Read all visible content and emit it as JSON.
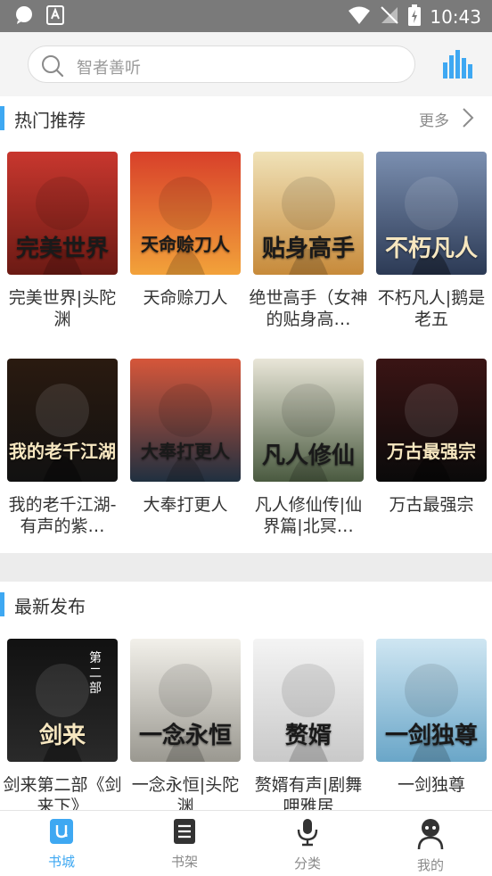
{
  "status_bar": {
    "time": "10:43"
  },
  "search": {
    "placeholder": "智者善听"
  },
  "hot": {
    "title": "热门推荐",
    "more": "更多",
    "books": [
      {
        "title": "完美世界|头陀渊",
        "cover_text": "完美世界",
        "colors": [
          "#c8372e",
          "#6b1a14"
        ]
      },
      {
        "title": "天命赊刀人",
        "cover_text": "天命赊刀人",
        "colors": [
          "#d8402a",
          "#f2a23a"
        ]
      },
      {
        "title": "绝世高手（女神的贴身高…",
        "cover_text": "贴身高手",
        "colors": [
          "#f0e2b8",
          "#c78a3a"
        ]
      },
      {
        "title": "不朽凡人|鹅是老五",
        "cover_text": "不朽凡人",
        "colors": [
          "#7b8fb0",
          "#2c3a55"
        ]
      },
      {
        "title": "我的老千江湖-有声的紫…",
        "cover_text": "我的老千江湖",
        "colors": [
          "#2a1a10",
          "#111111"
        ]
      },
      {
        "title": "大奉打更人",
        "cover_text": "大奉打更人",
        "colors": [
          "#d6563a",
          "#203040"
        ]
      },
      {
        "title": "凡人修仙传|仙界篇|北冥…",
        "cover_text": "凡人修仙",
        "colors": [
          "#e9e6d8",
          "#4a5a40"
        ]
      },
      {
        "title": "万古最强宗",
        "cover_text": "万古最强宗",
        "colors": [
          "#3a1414",
          "#0a0a0a"
        ]
      }
    ]
  },
  "latest": {
    "title": "最新发布",
    "books": [
      {
        "title": "剑来第二部《剑来下》",
        "cover_text": "剑来",
        "sub": "第二部",
        "colors": [
          "#111111",
          "#2a2a2a"
        ]
      },
      {
        "title": "一念永恒|头陀渊",
        "cover_text": "一念永恒",
        "colors": [
          "#f2f0ea",
          "#9a9890"
        ]
      },
      {
        "title": "赘婿有声|剧舞呷雅居",
        "cover_text": "赘婿",
        "colors": [
          "#f4f4f4",
          "#c9c9c9"
        ]
      },
      {
        "title": "一剑独尊",
        "cover_text": "一剑独尊",
        "colors": [
          "#cfe6f2",
          "#6aa6c8"
        ]
      }
    ]
  },
  "tabs": [
    {
      "label": "书城",
      "icon": "bookstore-icon",
      "active": true
    },
    {
      "label": "书架",
      "icon": "bookshelf-icon",
      "active": false
    },
    {
      "label": "分类",
      "icon": "microphone-icon",
      "active": false
    },
    {
      "label": "我的",
      "icon": "profile-icon",
      "active": false
    }
  ],
  "colors": {
    "accent": "#3ea8f2",
    "status_bar": "#7a7a7a",
    "header_bg": "#f4f4f4"
  }
}
